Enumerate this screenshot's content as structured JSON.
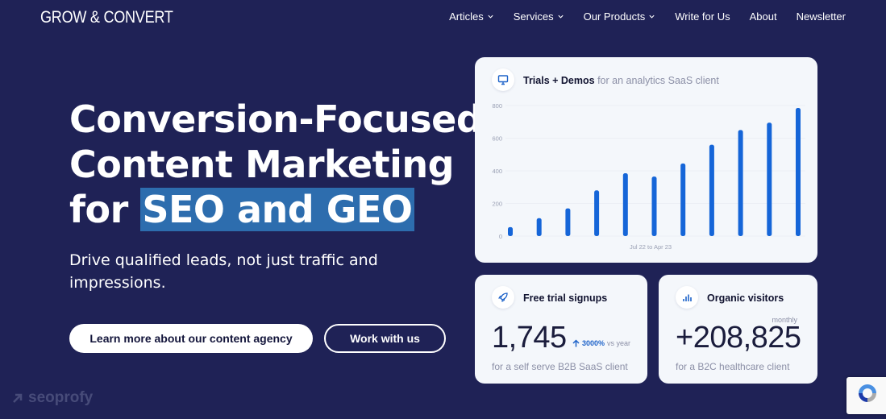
{
  "nav": {
    "logo": "GROW & CONVERT",
    "items": [
      {
        "label": "Articles",
        "dropdown": true
      },
      {
        "label": "Services",
        "dropdown": true
      },
      {
        "label": "Our Products",
        "dropdown": true
      },
      {
        "label": "Write for Us",
        "dropdown": false
      },
      {
        "label": "About",
        "dropdown": false
      },
      {
        "label": "Newsletter",
        "dropdown": false
      }
    ]
  },
  "hero": {
    "title_line1": "Conversion-Focused",
    "title_line2": "Content Marketing",
    "title_line3_prefix": "for ",
    "title_line3_highlight": "SEO and GEO",
    "subtitle": "Drive qualified leads, not just traffic and impressions.",
    "cta_primary": "Learn more about our content agency",
    "cta_secondary": "Work with us"
  },
  "chart_card": {
    "icon": "monitor-icon",
    "title_bold": "Trials + Demos",
    "title_muted": "for an analytics SaaS client"
  },
  "chart_data": {
    "type": "bar",
    "title": "Trials + Demos",
    "xlabel": "Jul 22 to Apr 23",
    "y_ticks": [
      "800",
      "600",
      "400",
      "200",
      "0"
    ],
    "ylim": [
      0,
      800
    ],
    "values": [
      55,
      110,
      170,
      280,
      385,
      365,
      445,
      560,
      650,
      695,
      785
    ],
    "grid": true,
    "bar_color": "#1565d8"
  },
  "trials_card": {
    "icon": "rocket-icon",
    "title": "Free trial signups",
    "value": "1,745",
    "growth_pct": "3000%",
    "growth_suffix": "vs year",
    "footnote": "for a self serve B2B SaaS client"
  },
  "visitors_card": {
    "icon": "bar-chart-icon",
    "title": "Organic visitors",
    "period": "monthly",
    "value": "+208,825",
    "footnote": "for a B2C healthcare client"
  },
  "watermark": {
    "text": "seoprofy"
  },
  "colors": {
    "background": "#1f2256",
    "highlight": "#2d6dae",
    "accent_blue": "#1e63c9",
    "card_bg": "#f4f7fb"
  }
}
